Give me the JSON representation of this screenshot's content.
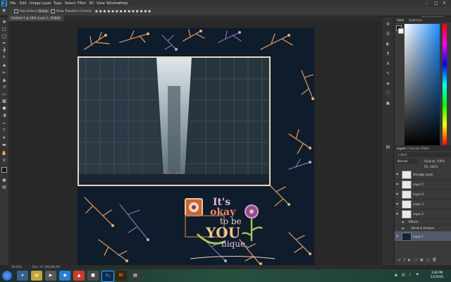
{
  "app": {
    "logo": "Ps"
  },
  "menu": [
    "File",
    "Edit",
    "Image",
    "Layer",
    "Type",
    "Select",
    "Filter",
    "3D",
    "View",
    "Window",
    "Help"
  ],
  "options": {
    "auto_select": "Auto-Select:",
    "auto_select_value": "Group",
    "transform": "Show Transform Controls",
    "workspace": "Essentials"
  },
  "document": {
    "tab_title": "Untitled-1 @ 18% (Layer 1, RGB/8)",
    "status_zoom": "18.03%",
    "status_doc": "Doc: 37.1M/168.0M"
  },
  "artwork": {
    "line1": "It's",
    "line2": "okay",
    "line3": "to be",
    "line4": "YOU",
    "line5": "nique."
  },
  "right_panel": {
    "color_tab": "Color",
    "swatches_tab": "Swatches",
    "layers_tab": "Layers",
    "channels_tab": "Channels",
    "paths_tab": "Paths",
    "blend_mode": "Normal",
    "opacity_label": "Opacity: 100%",
    "fill_label": "Fill: 100%",
    "layers": [
      {
        "name": "Smudge Layer",
        "thumb": "#e8e8e8"
      },
      {
        "name": "Layer 5",
        "thumb": "#e8e8e8"
      },
      {
        "name": "Layer 4",
        "thumb": "#e8e8e8"
      },
      {
        "name": "Layer 3",
        "thumb": "#e8e8e8"
      },
      {
        "name": "Layer 2",
        "thumb": "#e8e8e8"
      },
      {
        "name": "Effects",
        "thumb": ""
      },
      {
        "name": "Bevel & Emboss",
        "thumb": ""
      },
      {
        "name": "Layer 1",
        "thumb": "#10243a"
      }
    ]
  },
  "taskbar": {
    "time": "3:40 PM",
    "date": "2/1/2016"
  },
  "icons": [
    "move-icon",
    "marquee-icon",
    "lasso-icon",
    "quick-select-icon",
    "crop-icon",
    "eyedropper-icon",
    "heal-icon",
    "brush-icon",
    "stamp-icon",
    "history-brush-icon",
    "eraser-icon",
    "gradient-icon",
    "blur-icon",
    "dodge-icon",
    "pen-icon",
    "type-icon",
    "path-select-icon",
    "shape-icon",
    "hand-icon",
    "zoom-icon"
  ],
  "colors": {
    "accent": "#31a8ff",
    "doc_bg": "#0e1c2c",
    "frame": "#e9d6bf",
    "selected_layer": "#505a68"
  }
}
